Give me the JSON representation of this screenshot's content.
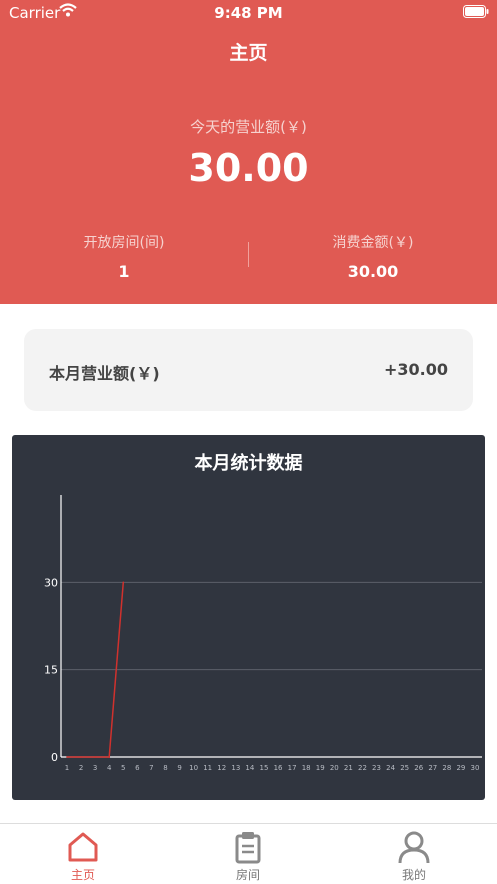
{
  "status_bar": {
    "carrier": "Carrier",
    "time": "9:48 PM"
  },
  "header": {
    "title": "主页",
    "today_label": "今天的营业额(￥)",
    "today_value": "30.00",
    "open_rooms_label": "开放房间(间)",
    "open_rooms_value": "1",
    "consumption_label": "消费金额(￥)",
    "consumption_value": "30.00"
  },
  "month_card": {
    "label": "本月营业额(￥)",
    "value": "+30.00"
  },
  "chart_data": {
    "type": "line",
    "title": "本月统计数据",
    "x": [
      1,
      2,
      3,
      4,
      5,
      6,
      7,
      8,
      9,
      10,
      11,
      12,
      13,
      14,
      15,
      16,
      17,
      18,
      19,
      20,
      21,
      22,
      23,
      24,
      25,
      26,
      27,
      28,
      29,
      30
    ],
    "series": [
      {
        "values": [
          0,
          0,
          0,
          0,
          30,
          null,
          null,
          null,
          null,
          null,
          null,
          null,
          null,
          null,
          null,
          null,
          null,
          null,
          null,
          null,
          null,
          null,
          null,
          null,
          null,
          null,
          null,
          null,
          null,
          null
        ]
      }
    ],
    "y_ticks": [
      "0",
      "15",
      "30"
    ],
    "ylim": [
      0,
      45
    ],
    "grid": true,
    "line_color": "#d0312d"
  },
  "tabs": [
    {
      "label": "主页",
      "icon": "home-icon",
      "active": true
    },
    {
      "label": "房间",
      "icon": "clipboard-icon",
      "active": false
    },
    {
      "label": "我的",
      "icon": "profile-icon",
      "active": false
    }
  ],
  "colors": {
    "brand": "#e05a53",
    "chart_bg": "#30353f"
  }
}
